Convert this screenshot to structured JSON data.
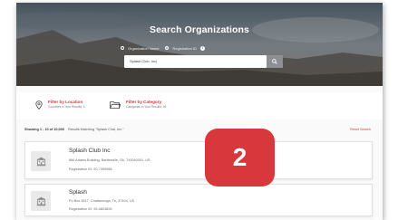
{
  "hero": {
    "title": "Search Organizations",
    "radio_options": [
      {
        "label": "Organization Name",
        "selected": false
      },
      {
        "label": "Registration ID",
        "selected": true
      }
    ],
    "search_value": "Splash Club, Inc|"
  },
  "filters": {
    "location": {
      "title": "Filter by Location",
      "subtitle": "Countries in Your Results: 1"
    },
    "category": {
      "title": "Filter by Category",
      "subtitle": "Categories in Your Results: 26"
    }
  },
  "results": {
    "showing_prefix": "Showing 1 - 10 of 10,000",
    "matching_text": "Results Matching \"Splash Club, Inc.\"",
    "reset_label": "Reset Search",
    "items": [
      {
        "name": "Splash Club Inc",
        "address": "866 Adams Building, Bartlesville, Ok, 740040001, US",
        "registration": "Registration ID: 20-7499968"
      },
      {
        "name": "Splash",
        "address": "Po Box 3617, Chattanooga, Tn, 37404, US",
        "registration": "Registration ID: 99-0824826"
      }
    ]
  },
  "step_badge": "2",
  "colors": {
    "accent": "#d7363b",
    "badge": "#d8373c",
    "search_button": "#8d9093"
  }
}
